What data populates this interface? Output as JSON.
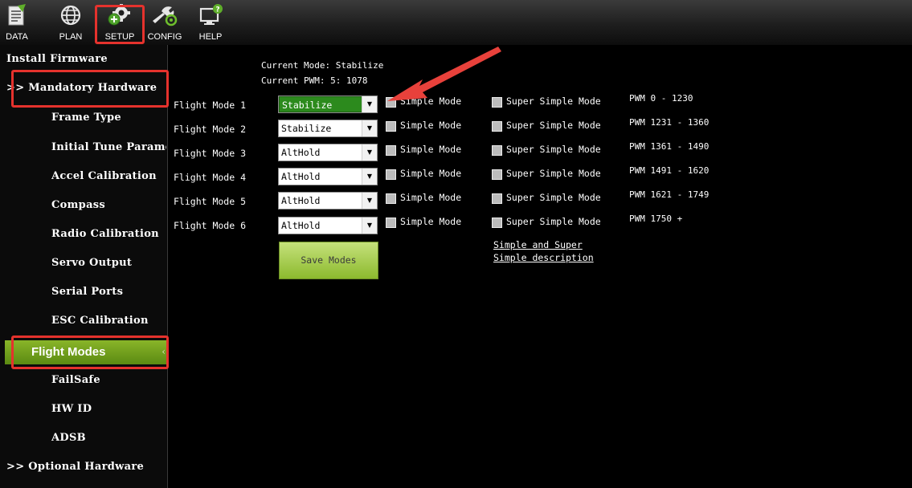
{
  "toolbar": {
    "items": [
      {
        "label": "DATA",
        "icon": "data-icon"
      },
      {
        "label": "PLAN",
        "icon": "plan-globe-icon"
      },
      {
        "label": "SETUP",
        "icon": "setup-gear-icon"
      },
      {
        "label": "CONFIG",
        "icon": "config-wrench-icon"
      },
      {
        "label": "HELP",
        "icon": "help-monitor-icon"
      }
    ],
    "highlighted": "SETUP"
  },
  "sidebar": {
    "install_firmware": "Install Firmware",
    "mandatory_hardware": ">> Mandatory Hardware",
    "items": [
      "Frame Type",
      "Initial Tune Parameters",
      "Accel Calibration",
      "Compass",
      "Radio Calibration",
      "Servo Output",
      "Serial Ports",
      "ESC Calibration"
    ],
    "active": "Flight Modes",
    "items_after": [
      "FailSafe",
      "HW ID",
      "ADSB"
    ],
    "optional_hardware": ">> Optional Hardware"
  },
  "main": {
    "current_mode": "Current Mode: Stabilize",
    "current_pwm": "Current PWM: 5: 1078",
    "flight_modes": [
      {
        "label": "Flight Mode 1",
        "value": "Stabilize",
        "simple": "Simple Mode",
        "super_simple": "Super Simple Mode",
        "pwm": "PWM 0 - 1230"
      },
      {
        "label": "Flight Mode 2",
        "value": "Stabilize",
        "simple": "Simple Mode",
        "super_simple": "Super Simple Mode",
        "pwm": "PWM 1231 - 1360"
      },
      {
        "label": "Flight Mode 3",
        "value": "AltHold",
        "simple": "Simple Mode",
        "super_simple": "Super Simple Mode",
        "pwm": "PWM 1361 - 1490"
      },
      {
        "label": "Flight Mode 4",
        "value": "AltHold",
        "simple": "Simple Mode",
        "super_simple": "Super Simple Mode",
        "pwm": "PWM 1491 - 1620"
      },
      {
        "label": "Flight Mode 5",
        "value": "AltHold",
        "simple": "Simple Mode",
        "super_simple": "Super Simple Mode",
        "pwm": "PWM 1621 - 1749"
      },
      {
        "label": "Flight Mode 6",
        "value": "AltHold",
        "simple": "Simple Mode",
        "super_simple": "Super Simple Mode",
        "pwm": "PWM 1750 +"
      }
    ],
    "save_button": "Save Modes",
    "description_link_line1": "Simple and Super",
    "description_link_line2": "Simple description"
  },
  "colors": {
    "highlight_box": "#e5322d",
    "active_menu": "#6f9e1c",
    "selected_dropdown": "#2c8a1d",
    "arrow": "#e8413b"
  }
}
